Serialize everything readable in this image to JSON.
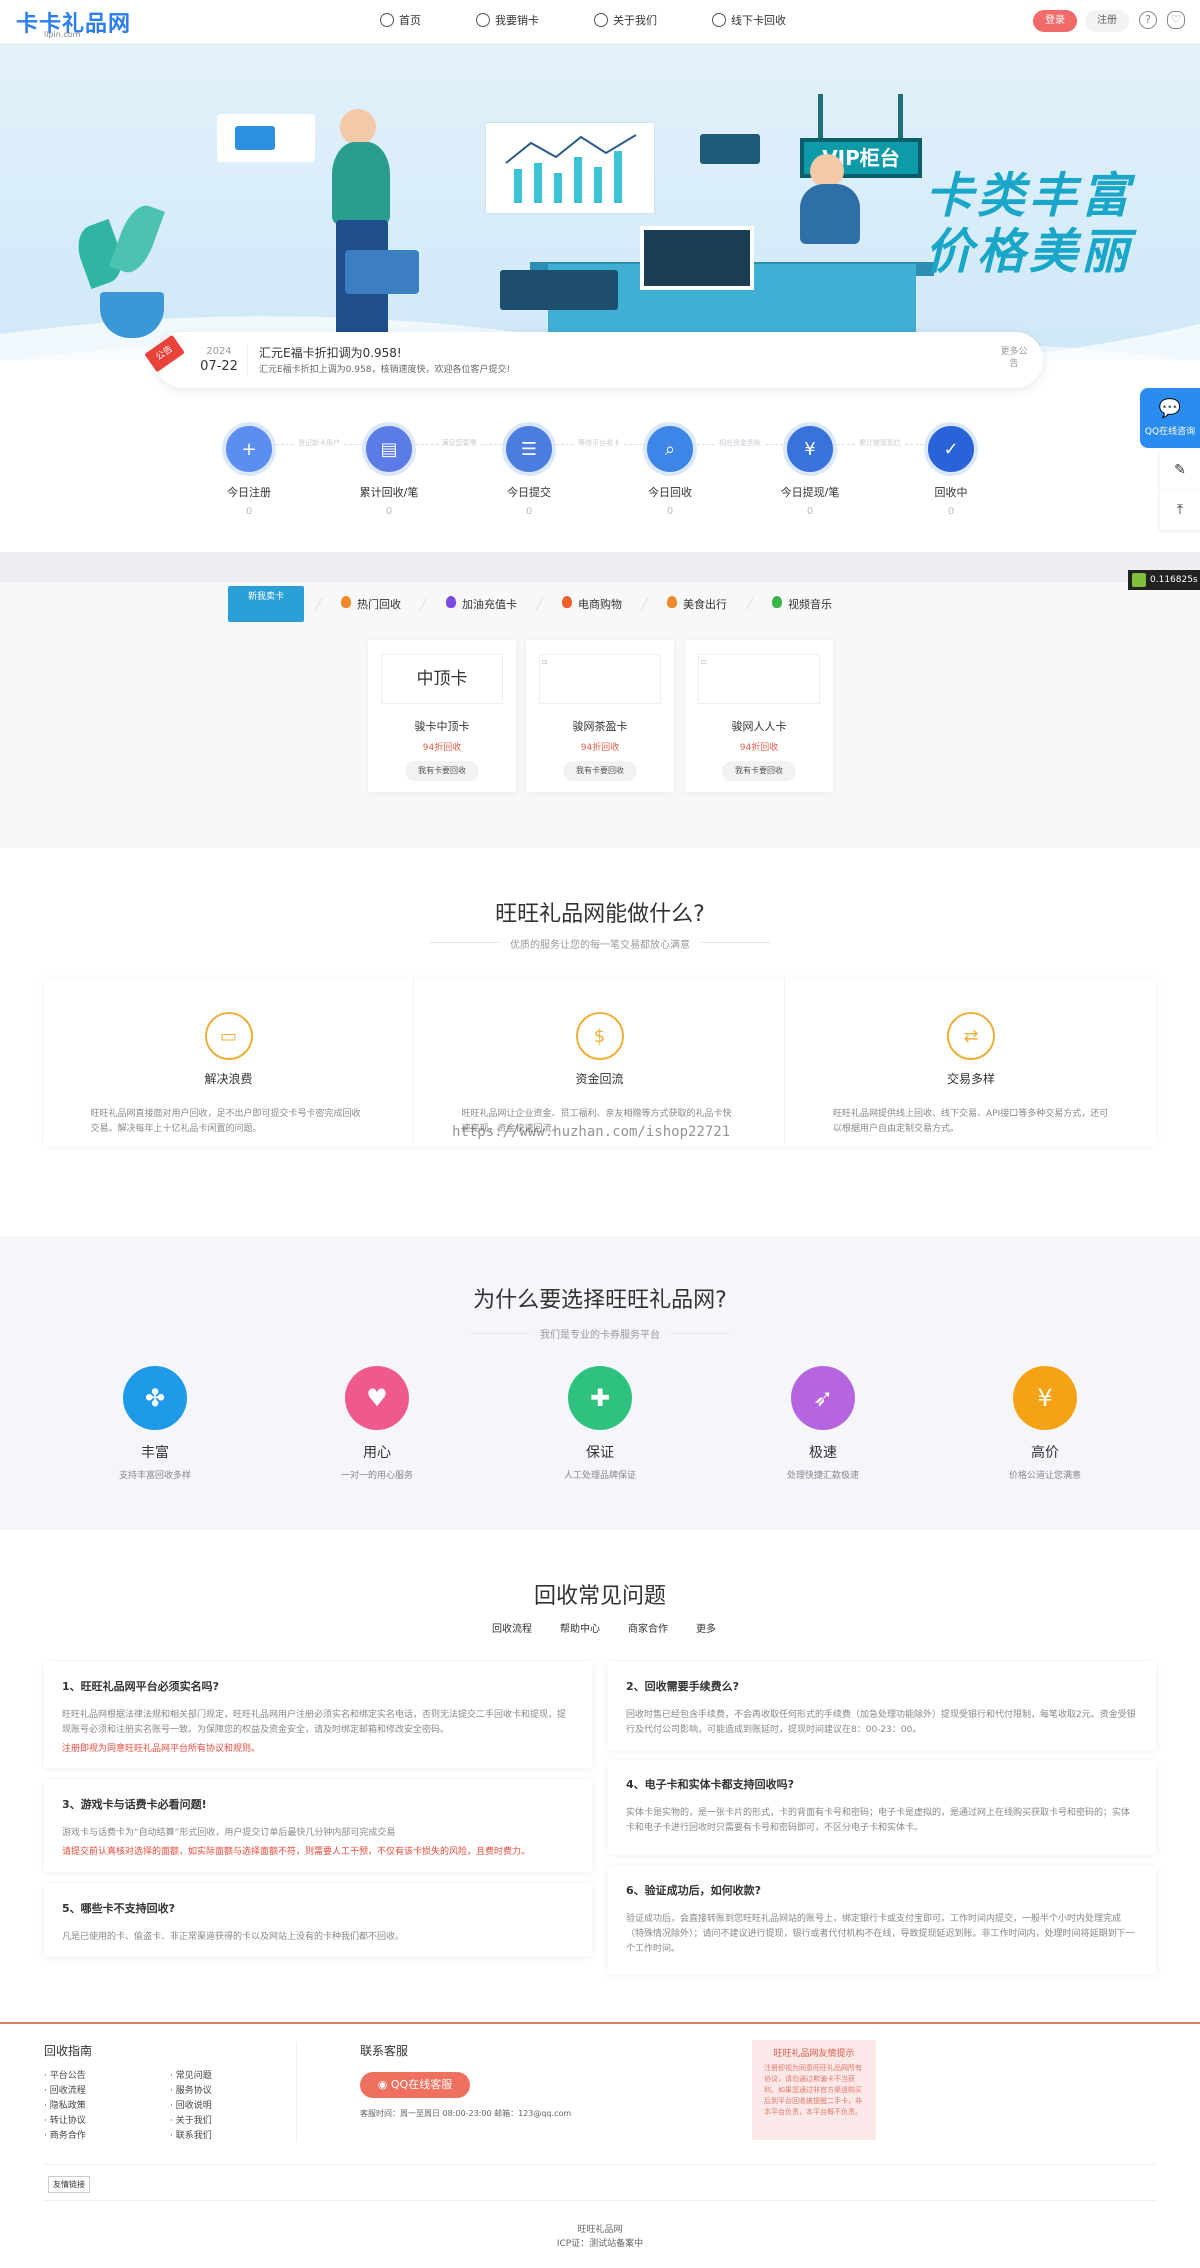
{
  "header": {
    "logo": "卡卡礼品网",
    "logo_sub": "lipin.com",
    "nav": [
      {
        "label": "首页",
        "icon": "home-icon"
      },
      {
        "label": "我要销卡",
        "icon": "card-icon"
      },
      {
        "label": "关于我们",
        "icon": "info-icon"
      },
      {
        "label": "线下卡回收",
        "icon": "store-icon"
      }
    ],
    "login": "登录",
    "register": "注册"
  },
  "banner": {
    "slogan1": "卡类丰富",
    "slogan2": "价格美丽",
    "vip": "VIP柜台"
  },
  "notice": {
    "tag": "公告",
    "year": "2024",
    "date": "07-22",
    "title": "汇元E福卡折扣调为0.958!",
    "text": "汇元E福卡折扣上调为0.958，核销速度快，欢迎各位客户提交!",
    "more": "更多公告"
  },
  "stats": [
    {
      "label": "今日注册",
      "value": "0",
      "icon": "add-user-icon"
    },
    {
      "label": "累计回收/笔",
      "value": "0",
      "icon": "id-card-icon"
    },
    {
      "label": "今日提交",
      "value": "0",
      "icon": "document-icon"
    },
    {
      "label": "今日回收",
      "value": "0",
      "icon": "search-doc-icon"
    },
    {
      "label": "今日提现/笔",
      "value": "0",
      "icon": "withdraw-icon"
    },
    {
      "label": "回收中",
      "value": "0",
      "icon": "check-icon"
    }
  ],
  "stat_links": [
    "登记新卡用户",
    "满足您要需",
    "等待平台收卡",
    "相应资金到账",
    "累计提现到位"
  ],
  "categories": {
    "logo": "新我卖卡",
    "tabs": [
      {
        "label": "热门回收",
        "color": "#f08a2a"
      },
      {
        "label": "加油充值卡",
        "color": "#7b4be0"
      },
      {
        "label": "电商购物",
        "color": "#f0602a"
      },
      {
        "label": "美食出行",
        "color": "#f08a2a"
      },
      {
        "label": "视频音乐",
        "color": "#3ab54a"
      }
    ],
    "products": [
      {
        "image_text": "中顶卡",
        "name": "骏卡中顶卡",
        "rate": "94折回收",
        "button": "我有卡要回收"
      },
      {
        "image_text": "",
        "name": "骏网茶盈卡",
        "rate": "94折回收",
        "button": "我有卡要回收"
      },
      {
        "image_text": "",
        "name": "骏网人人卡",
        "rate": "94折回收",
        "button": "我有卡要回收"
      }
    ]
  },
  "what": {
    "title": "旺旺礼品网能做什么?",
    "subtitle": "优质的服务让您的每一笔交易都放心满意",
    "features": [
      {
        "name": "解决浪费",
        "desc": "旺旺礼品网直接面对用户回收，足不出户即可提交卡号卡密完成回收交易。解决每年上十亿礼品卡闲置的问题。",
        "icon": "card-icon"
      },
      {
        "name": "资金回流",
        "desc": "旺旺礼品网让企业资金、员工福利、亲友相赠等方式获取的礼品卡快速变现，资金快速回流。",
        "icon": "money-cycle-icon"
      },
      {
        "name": "交易多样",
        "desc": "旺旺礼品网提供线上回收、线下交易、API接口等多种交易方式，还可以根据用户自由定制交易方式。",
        "icon": "exchange-icon"
      }
    ],
    "watermark": "https://www.huzhan.com/ishop22721"
  },
  "why": {
    "title": "为什么要选择旺旺礼品网?",
    "subtitle": "我们是专业的卡券服务平台",
    "items": [
      {
        "name": "丰富",
        "desc": "支持丰富回收多样",
        "color": "#1e9ae8",
        "icon": "clover-icon"
      },
      {
        "name": "用心",
        "desc": "一对一的用心服务",
        "color": "#ef5a8a",
        "icon": "heart-icon"
      },
      {
        "name": "保证",
        "desc": "人工处理品牌保证",
        "color": "#2ec27e",
        "icon": "shield-icon"
      },
      {
        "name": "极速",
        "desc": "处理快捷汇款极速",
        "color": "#b665e0",
        "icon": "rocket-icon"
      },
      {
        "name": "高价",
        "desc": "价格公道让您满意",
        "color": "#f5a214",
        "icon": "yen-icon"
      }
    ]
  },
  "faq": {
    "title": "回收常见问题",
    "tabs": [
      "回收流程",
      "帮助中心",
      "商家合作",
      "更多"
    ],
    "left": [
      {
        "q": "1、旺旺礼品网平台必须实名吗?",
        "a": "旺旺礼品网根据法律法规和相关部门规定，旺旺礼品网用户注册必须实名和绑定实名电话，否则无法提交二手回收卡和提现，提现账号必须和注册实名账号一致。为保障您的权益及资金安全，请及时绑定邮箱和修改安全密码。",
        "warn": "注册即视为同意旺旺礼品网平台所有协议和规则。"
      },
      {
        "q": "3、游戏卡与话费卡必看问题!",
        "a": "游戏卡与话费卡为“自动结算”形式回收，用户提交订单后最快几分钟内部可完成交易",
        "warn": "请提交前认真核对选择的面额，如实际面额与选择面额不符，则需要人工干预，不仅有该卡损失的风险，且费时费力。"
      },
      {
        "q": "5、哪些卡不支持回收?",
        "a": "凡是已使用的卡、偷盗卡、非正常渠道获得的卡以及网站上没有的卡种我们都不回收。",
        "warn": ""
      }
    ],
    "right": [
      {
        "q": "2、回收需要手续费么?",
        "a": "回收时售已经包含手续费，不会再收取任何形式的手续费（加急处理功能除外）提现受银行和代付限制，每笔收取2元。资金受银行及代付公司影响，可能造成到账延时，提现时间建议在8：00-23：00。"
      },
      {
        "q": "4、电子卡和实体卡都支持回收吗?",
        "a": "实体卡是实物的，是一张卡片的形式，卡的背面有卡号和密码；电子卡是虚拟的，是通过网上在线购买获取卡号和密码的；实体卡和电子卡进行回收时只需要有卡号和密码即可，不区分电子卡和实体卡。"
      },
      {
        "q": "6、验证成功后，如何收款?",
        "a": "验证成功后，会直接转账到您旺旺礼品网站的账号上，绑定银行卡或支付宝即可。工作时间内提交，一般半个小时内处理完成（特殊情况除外）；请问不建议进行提现，银行或者代付机构不在线，导致提现延迟到账。非工作时间内，处理时间将延期到下一个工作时间。"
      }
    ]
  },
  "footer": {
    "guide_title": "回收指南",
    "guide_col1": [
      "平台公告",
      "回收流程",
      "隐私政策",
      "转让协议",
      "商务合作"
    ],
    "guide_col2": [
      "常见问题",
      "服务协议",
      "回收说明",
      "关于我们",
      "联系我们"
    ],
    "contact_title": "联系客服",
    "qq_button": "QQ在线客服",
    "contact_info": "客服时间：周一至周日 08:00-23:00  邮箱：123@qq.com",
    "tip_title": "旺旺礼品网友情提示",
    "tip_text": "注册即视为同意旺旺礼品网所有协议，请勿通过欺骗卡不当获利。如果您通过非官方渠道购买后到平台回收被提醒二手卡，非本平台负责，本平台概不负责。",
    "friend_links": "友情链接",
    "copy1": "旺旺礼品网",
    "copy2": "ICP证：测试站备案中"
  },
  "side": {
    "qq": "QQ在线咨询",
    "timer": "0.116825s"
  }
}
